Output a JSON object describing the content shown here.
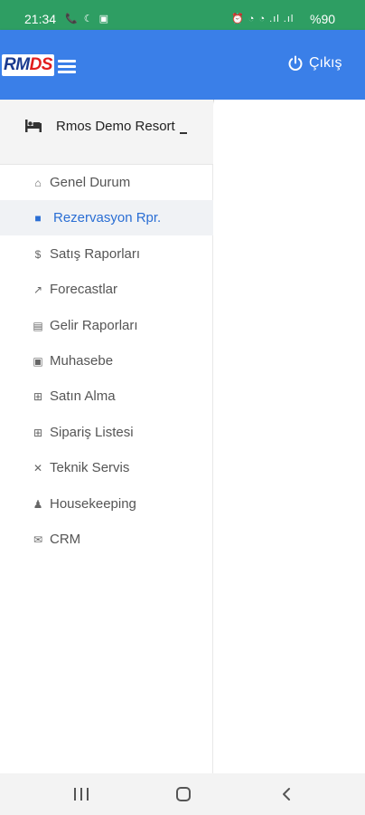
{
  "status_bar": {
    "time": "21:34",
    "left_icons": "📞 ☾ ▣",
    "right_icons": "⏰ ◔ ◔ .ıl .ıl",
    "battery": "%90"
  },
  "app_bar": {
    "logo_part1": "RM",
    "logo_part2": "DS",
    "logout_label": "Çıkış",
    "accent_color": "#3a7fe8"
  },
  "drawer": {
    "hotel_name": "Rmos Demo Resort",
    "items": [
      {
        "label": "Genel Durum",
        "icon": "home-icon",
        "glyph": "⌂",
        "active": false
      },
      {
        "label": "Rezervasyon Rpr.",
        "icon": "suitcase-icon",
        "glyph": "■",
        "active": true
      },
      {
        "label": "Satış Raporları",
        "icon": "dollar-icon",
        "glyph": "$",
        "active": false
      },
      {
        "label": "Forecastlar",
        "icon": "trending-up-icon",
        "glyph": "↗",
        "active": false
      },
      {
        "label": "Gelir Raporları",
        "icon": "document-icon",
        "glyph": "▤",
        "active": false
      },
      {
        "label": "Muhasebe",
        "icon": "briefcase-icon",
        "glyph": "▣",
        "active": false
      },
      {
        "label": "Satın Alma",
        "icon": "add-box-icon",
        "glyph": "⊞",
        "active": false
      },
      {
        "label": "Sipariş Listesi",
        "icon": "add-box-icon",
        "glyph": "⊞",
        "active": false
      },
      {
        "label": "Teknik Servis",
        "icon": "shuffle-icon",
        "glyph": "✕",
        "active": false
      },
      {
        "label": "Housekeeping",
        "icon": "bell-icon",
        "glyph": "♟",
        "active": false
      },
      {
        "label": "CRM",
        "icon": "mail-icon",
        "glyph": "✉",
        "active": false
      }
    ]
  }
}
